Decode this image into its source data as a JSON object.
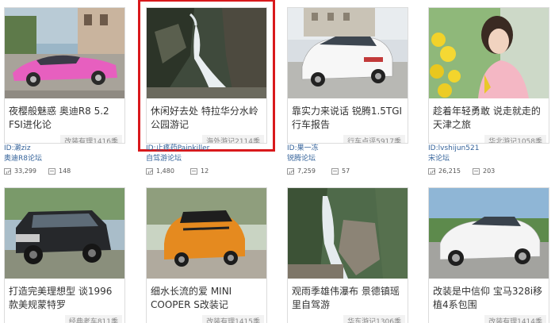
{
  "cards": [
    {
      "title": "夜樱般魅惑 奥迪R8 5.2 FSI进化论",
      "tag": "改装有理1416季",
      "user": "ID:濑ziz",
      "forum": "奥迪R8论坛",
      "views": "33,299",
      "comments": "148"
    },
    {
      "title": "休闲好去处 特拉华分水岭公园游记",
      "tag": "海外游记2114季",
      "user": "ID:止疼药Painkiller",
      "forum": "自驾游论坛",
      "views": "1,480",
      "comments": "12"
    },
    {
      "title": "靠实力来说话 锐腾1.5TGI行车报告",
      "tag": "行车点评5917季",
      "user": "ID:果一冻",
      "forum": "锐腾论坛",
      "views": "7,259",
      "comments": "57"
    },
    {
      "title": "趁着年轻勇敢 说走就走的天津之旅",
      "tag": "华北游记1058季",
      "user": "ID:lvshijun521",
      "forum": "宋论坛",
      "views": "26,215",
      "comments": "203"
    },
    {
      "title": "打造完美理想型 谈1996款美规蒙特罗",
      "tag": "经典老车811季"
    },
    {
      "title": "细水长流的爱 MINI COOPER S改装记",
      "tag": "改装有理1415季"
    },
    {
      "title": "观雨季雄伟瀑布 景德镇瑶里自驾游",
      "tag": "华东游记1306季"
    },
    {
      "title": "改装是中信仰 宝马328i移植4系包围",
      "tag": "改装有理1414季"
    }
  ]
}
